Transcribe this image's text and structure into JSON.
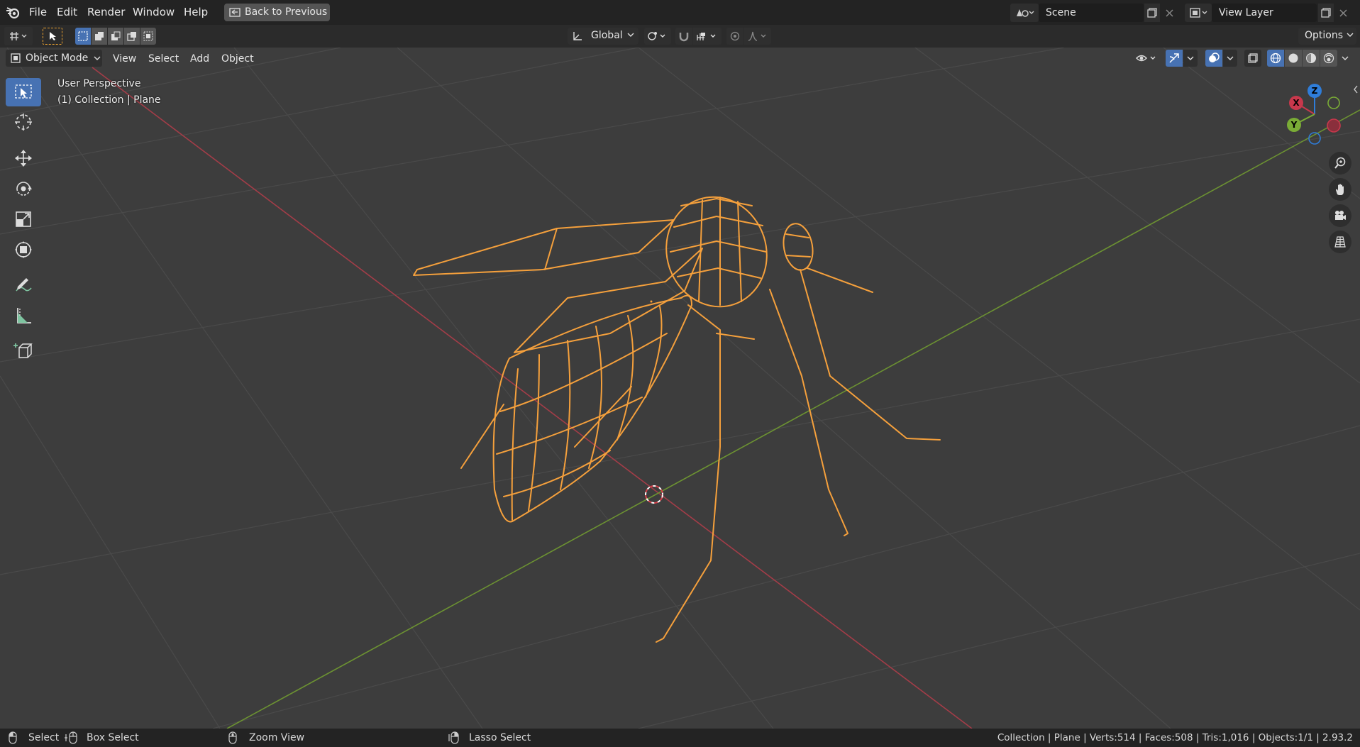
{
  "menu": {
    "file": "File",
    "edit": "Edit",
    "render": "Render",
    "window": "Window",
    "help": "Help",
    "back_button": "Back to Previous"
  },
  "scene": {
    "value": "Scene"
  },
  "view_layer": {
    "value": "View Layer"
  },
  "toolbar": {
    "orientation": "Global",
    "options_label": "Options"
  },
  "header": {
    "mode": "Object Mode",
    "view": "View",
    "select": "Select",
    "add": "Add",
    "object": "Object"
  },
  "viewport": {
    "perspective": "User Perspective",
    "collection": "(1) Collection | Plane"
  },
  "gizmo": {
    "x": "X",
    "y": "Y",
    "z": "Z"
  },
  "status": {
    "select": "Select",
    "box_select": "Box Select",
    "zoom_view": "Zoom View",
    "lasso_select": "Lasso Select",
    "stats": "Collection | Plane | Verts:514 | Faces:508 | Tris:1,016 | Objects:1/1 | 2.93.2"
  },
  "colors": {
    "wire": "#f5a03c",
    "x_axis": "#c8384c",
    "y_axis": "#7aac36",
    "z_axis": "#2f7dd9",
    "active_tool": "#4772b3"
  }
}
